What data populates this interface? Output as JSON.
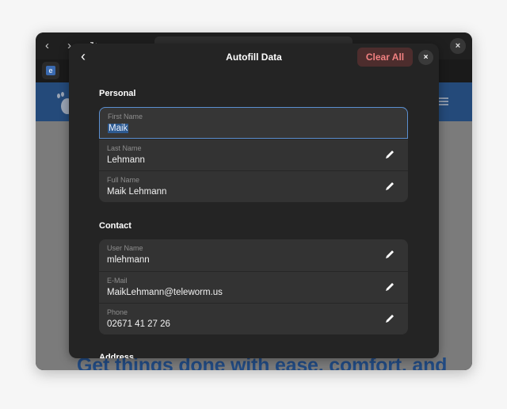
{
  "browser": {
    "back_icon": "chevron-left-icon",
    "forward_icon": "chevron-right-icon",
    "reload_icon": "reload-icon",
    "close_label": "×"
  },
  "page": {
    "headline": "Get things done with ease, comfort, and"
  },
  "dialog": {
    "title": "Autofill Data",
    "back_label": "‹",
    "clear_all_label": "Clear All",
    "close_label": "×",
    "colors": {
      "accent": "#5b8fd0",
      "destructive_text": "#f08080",
      "destructive_bg": "#4d2d2d"
    },
    "sections": [
      {
        "title": "Personal",
        "fields": [
          {
            "label": "First Name",
            "value": "Maik",
            "focused": true
          },
          {
            "label": "Last Name",
            "value": "Lehmann"
          },
          {
            "label": "Full Name",
            "value": "Maik Lehmann"
          }
        ]
      },
      {
        "title": "Contact",
        "fields": [
          {
            "label": "User Name",
            "value": "mlehmann"
          },
          {
            "label": "E-Mail",
            "value": "MaikLehmann@teleworm.us"
          },
          {
            "label": "Phone",
            "value": "02671 41 27 26"
          }
        ]
      },
      {
        "title": "Address"
      }
    ]
  }
}
